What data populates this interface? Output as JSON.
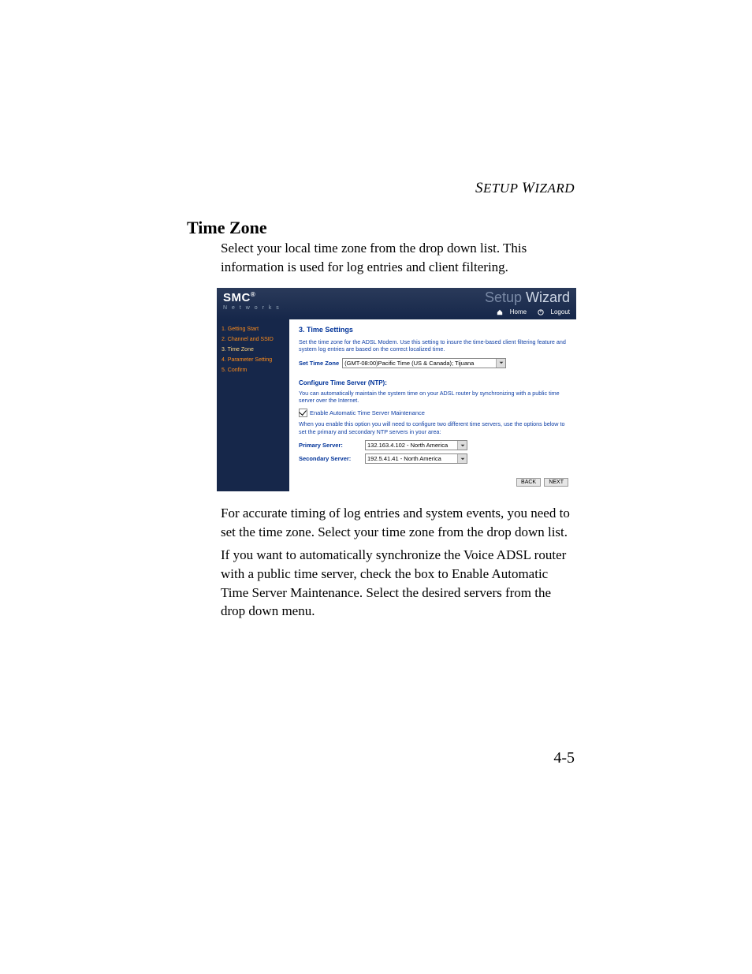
{
  "running_head": "SETUP WIZARD",
  "section_title": "Time Zone",
  "body1": "Select your local time zone from the drop down list. This information is used for log entries and client filtering.",
  "body2": "For accurate timing of log entries and system events, you need to set the time zone. Select your time zone from the drop down list.",
  "body3": "If you want to automatically synchronize the Voice ADSL router with a public time server, check the box to Enable Automatic Time Server Maintenance. Select the desired servers from the drop down menu.",
  "page_number": "4-5",
  "shot": {
    "logo": "SMC",
    "logo_sup": "®",
    "logo_sub": "N e t w o r k s",
    "wizard_a": "Setup ",
    "wizard_b": "Wizard",
    "link_home": "Home",
    "link_logout": "Logout",
    "sidebar": {
      "s1": "1. Getting Start",
      "s2": "2. Channel and SSID",
      "s3": "3. Time Zone",
      "s4": "4. Parameter Setting",
      "s5": "5. Confirm"
    },
    "heading": "3. Time Settings",
    "p1": "Set the time zone for the ADSL Modem. Use this setting to insure the time-based client filtering feature and system log entries are based on the correct localized time.",
    "set_tz_label": "Set Time Zone",
    "set_tz_value": "(GMT-08:00)Pacific Time (US & Canada); Tijuana",
    "ntp_heading": "Configure Time Server (NTP):",
    "p2": "You can automatically maintain the system time on your ADSL router by synchronizing with a public time server over the Internet.",
    "checkbox_label": "Enable Automatic Time Server Maintenance",
    "p3": "When you enable this option you will need to configure two different time servers, use the options below to set the primary and secondary NTP servers in your area:",
    "primary_label": "Primary Server:",
    "primary_value": "132.163.4.102 - North America",
    "secondary_label": "Secondary Server:",
    "secondary_value": "192.5.41.41 - North America",
    "btn_back": "BACK",
    "btn_next": "NEXT"
  }
}
